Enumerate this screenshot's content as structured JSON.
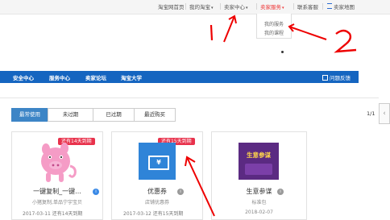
{
  "topbar": {
    "items": [
      "淘宝网首页",
      "我的淘宝",
      "卖家中心",
      "卖家服务",
      "联系客服",
      "卖家地图"
    ]
  },
  "dropdown": {
    "items": [
      "我的服务",
      "我的课程"
    ]
  },
  "navbar": {
    "items": [
      "安全中心",
      "服务中心",
      "卖家论坛",
      "淘宝大学"
    ],
    "feedback": "问题反馈"
  },
  "tabs": [
    "最常使用",
    "未过期",
    "已过期",
    "最近购买"
  ],
  "pager": "1/1",
  "cards": [
    {
      "ribbon": "还有14天到期",
      "title": "一键复制_一键...",
      "subtitle": "小猪复制,单品宁宇宝贝",
      "date": "2017-03-11  还有14天到期"
    },
    {
      "ribbon": "还有15天到期",
      "title": "优惠券",
      "subtitle": "店铺优惠券",
      "date": "2017-03-12  还有15天到期"
    },
    {
      "title": "生意参谋",
      "subtitle": "标准包",
      "date": "2018-02-07",
      "logo_text": "生意参谋"
    }
  ],
  "annotations": [
    "1",
    "2"
  ],
  "colors": {
    "nav_blue": "#1565c0",
    "tab_active": "#3d85c6",
    "ribbon_red": "#e8324c",
    "annotation_red": "#e00000"
  }
}
